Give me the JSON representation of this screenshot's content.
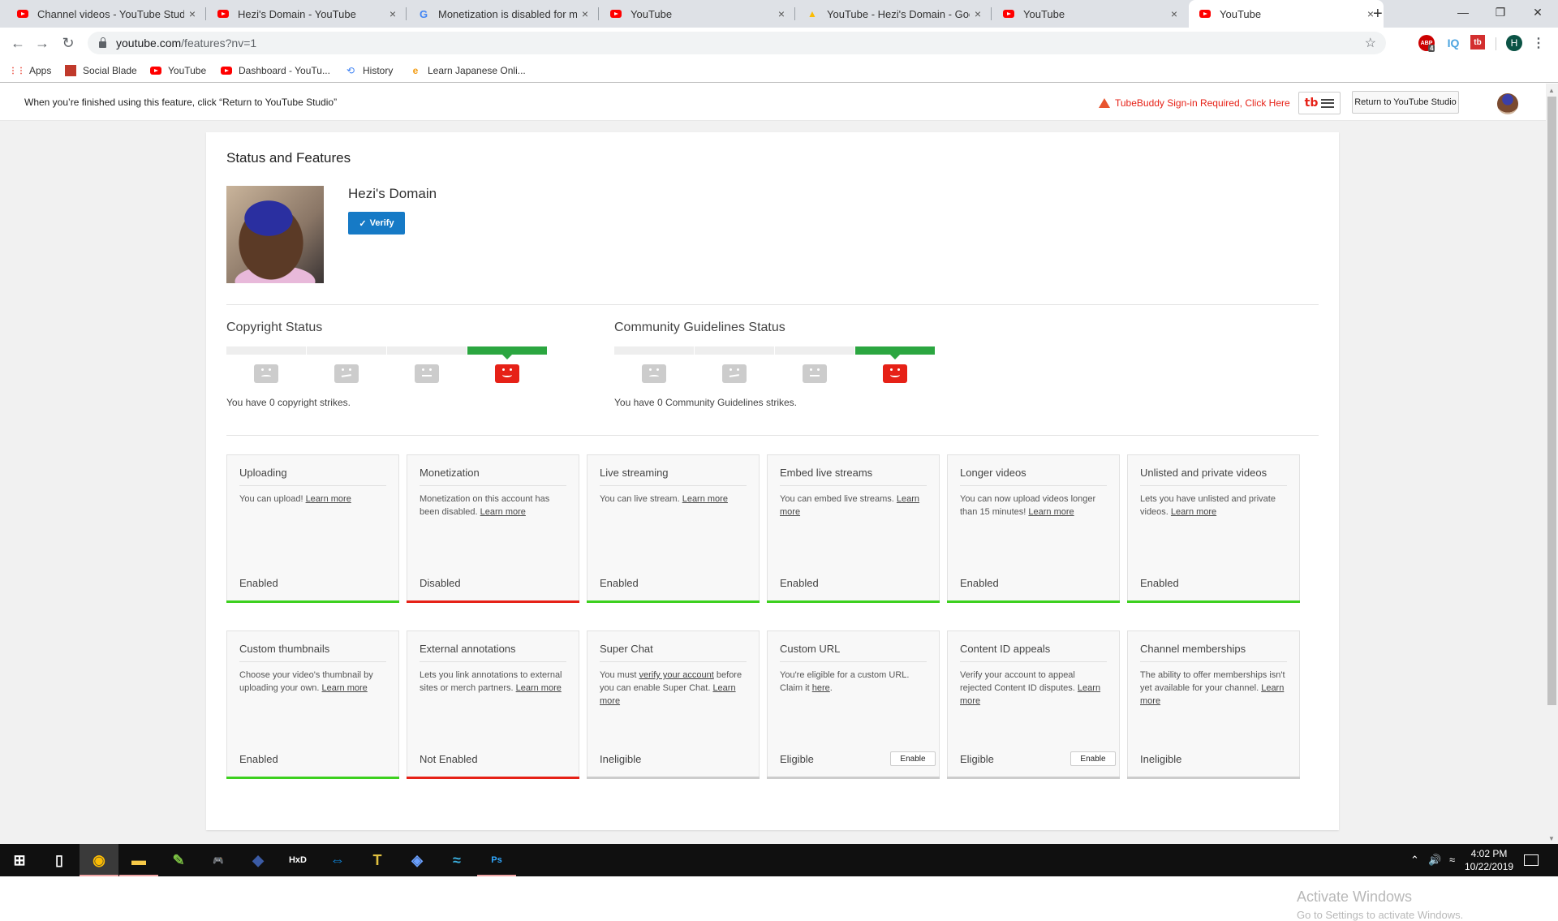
{
  "browser": {
    "tabs": [
      {
        "title": "Channel videos - YouTube Studio",
        "icon": "youtube-icon",
        "active": false
      },
      {
        "title": "Hezi's Domain - YouTube",
        "icon": "youtube-icon",
        "active": false
      },
      {
        "title": "Monetization is disabled for my c",
        "icon": "google-icon",
        "active": false
      },
      {
        "title": "YouTube",
        "icon": "youtube-icon",
        "active": false
      },
      {
        "title": "YouTube - Hezi's Domain - Goog",
        "icon": "google-ads-icon",
        "active": false
      },
      {
        "title": "YouTube",
        "icon": "youtube-icon",
        "active": false
      },
      {
        "title": "YouTube",
        "icon": "youtube-icon",
        "active": true
      }
    ],
    "new_tab": "+",
    "close_glyph": "×",
    "url_host": "youtube.com",
    "url_path": "/features?nv=1",
    "extensions": {
      "adblock_badge": "4",
      "adblock_label": "ABP",
      "iq_label": "IQ",
      "tubebuddy_label": "tb",
      "profile_initial": "H"
    },
    "bookmarks": [
      {
        "label": "Apps",
        "icon": "apps-grid-icon"
      },
      {
        "label": "Social Blade",
        "icon": "social-blade-icon"
      },
      {
        "label": "YouTube",
        "icon": "youtube-icon"
      },
      {
        "label": "Dashboard - YouTu...",
        "icon": "youtube-icon"
      },
      {
        "label": "History",
        "icon": "history-icon"
      },
      {
        "label": "Learn Japanese Onli...",
        "icon": "learn-japanese-icon"
      }
    ]
  },
  "notice": {
    "text": "When you’re finished using this feature, click “Return to YouTube Studio”",
    "tubebuddy_warning": "TubeBuddy Sign-in Required, Click Here",
    "tubebuddy_logo": "tb",
    "return_button": "Return to YouTube Studio"
  },
  "main": {
    "title": "Status and Features",
    "channel_name": "Hezi's Domain",
    "verify_label": "Verify",
    "verify_check": "✓",
    "copyright": {
      "title": "Copyright Status",
      "strikes": 0,
      "text": "You have 0 copyright strikes."
    },
    "community": {
      "title": "Community Guidelines Status",
      "strikes": 0,
      "text": "You have 0 Community Guidelines strikes."
    },
    "features": [
      {
        "title": "Uploading",
        "desc": "You can upload! ",
        "link": "Learn more",
        "status": "Enabled",
        "state": "enabled"
      },
      {
        "title": "Monetization",
        "desc": "Monetization on this account has been disabled. ",
        "link": "Learn more",
        "status": "Disabled",
        "state": "disabled"
      },
      {
        "title": "Live streaming",
        "desc": "You can live stream. ",
        "link": "Learn more",
        "status": "Enabled",
        "state": "enabled"
      },
      {
        "title": "Embed live streams",
        "desc": "You can embed live streams. ",
        "link": "Learn more",
        "status": "Enabled",
        "state": "enabled"
      },
      {
        "title": "Longer videos",
        "desc": "You can now upload videos longer than 15 minutes! ",
        "link": "Learn more",
        "status": "Enabled",
        "state": "enabled"
      },
      {
        "title": "Unlisted and private videos",
        "desc": "Lets you have unlisted and private videos. ",
        "link": "Learn more",
        "status": "Enabled",
        "state": "enabled"
      },
      {
        "title": "Custom thumbnails",
        "desc": "Choose your video's thumbnail by uploading your own. ",
        "link": "Learn more",
        "status": "Enabled",
        "state": "enabled"
      },
      {
        "title": "External annotations",
        "desc": "Lets you link annotations to external sites or merch partners. ",
        "link": "Learn more",
        "status": "Not Enabled",
        "state": "disabled"
      },
      {
        "title": "Super Chat",
        "desc_pre": "You must ",
        "desc_link": "verify your account",
        "desc": " before you can enable Super Chat. ",
        "link": "Learn more",
        "status": "Ineligible",
        "state": "neutral"
      },
      {
        "title": "Custom URL",
        "desc": "You're eligible for a custom URL. Claim it ",
        "link": "here",
        "desc_post": ".",
        "status": "Eligible",
        "state": "neutral",
        "button": "Enable"
      },
      {
        "title": "Content ID appeals",
        "desc": "Verify your account to appeal rejected Content ID disputes. ",
        "link": "Learn more",
        "status": "Eligible",
        "state": "neutral",
        "button": "Enable"
      },
      {
        "title": "Channel memberships",
        "desc": "The ability to offer memberships isn't yet available for your channel. ",
        "link": "Learn more",
        "status": "Ineligible",
        "state": "neutral"
      }
    ]
  },
  "watermark": {
    "line1": "Activate Windows",
    "line2": "Go to Settings to activate Windows."
  },
  "taskbar": {
    "apps": [
      "start-icon",
      "task-view-icon",
      "chrome-icon",
      "file-explorer-icon",
      "notepad-icon",
      "gamepad-icon",
      "halo-icon",
      "hxd-icon",
      "teamviewer-icon",
      "tekken-icon",
      "pcsx2-icon",
      "dolphin-icon",
      "photoshop-icon"
    ],
    "time": "4:02 PM",
    "date": "10/22/2019"
  },
  "colors": {
    "enabled": "#2ba640",
    "enabled_bar": "#3dd01f",
    "disabled": "#e62117",
    "neutral_bar": "#cccccc",
    "accent": "#167ac6"
  }
}
